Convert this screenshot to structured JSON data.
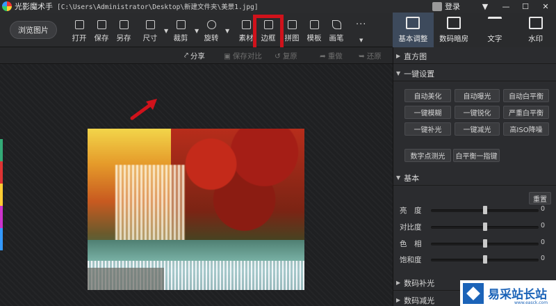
{
  "window": {
    "app_name": "光影魔术手",
    "path": "[C:\\Users\\Administrator\\Desktop\\新建文件夹\\美景1.jpg]",
    "login_label": "登录",
    "controls": [
      "▼",
      "—",
      "☐",
      "✕"
    ]
  },
  "toolbar": {
    "browse_label": "浏览图片",
    "tools": [
      {
        "label": "打开",
        "icon": "open-icon"
      },
      {
        "label": "保存",
        "icon": "save-icon"
      },
      {
        "label": "另存",
        "icon": "save-as-icon"
      },
      {
        "label": "尺寸",
        "icon": "resize-icon"
      },
      {
        "label": "裁剪",
        "icon": "crop-icon"
      },
      {
        "label": "旋转",
        "icon": "rotate-icon"
      },
      {
        "label": "素材",
        "icon": "material-icon"
      },
      {
        "label": "边框",
        "icon": "border-icon"
      },
      {
        "label": "拼图",
        "icon": "collage-icon"
      },
      {
        "label": "模板",
        "icon": "template-icon"
      },
      {
        "label": "画笔",
        "icon": "brush-icon"
      }
    ],
    "more_label": "···"
  },
  "right_tabs": [
    {
      "label": "基本调整",
      "icon": "adjust-icon",
      "active": true
    },
    {
      "label": "数码暗房",
      "icon": "darkroom-icon",
      "active": false
    },
    {
      "label": "文字",
      "icon": "text-icon",
      "active": false
    },
    {
      "label": "水印",
      "icon": "watermark-icon",
      "active": false
    }
  ],
  "subbar": {
    "share": "分享",
    "save_compare": "保存对比",
    "reset_all": "复原",
    "undo": "重做",
    "redo": "还原"
  },
  "panel": {
    "histogram": "直方图",
    "one_click": "一键设置",
    "one_click_buttons": [
      [
        "自动美化",
        "自动曝光",
        "自动白平衡"
      ],
      [
        "一键模糊",
        "一键锐化",
        "严重白平衡"
      ],
      [
        "一键补光",
        "一键减光",
        "高ISO降噪"
      ]
    ],
    "extra_buttons": [
      "数字点测光",
      "白平衡一指键"
    ],
    "basic": "基本",
    "reset": "重置",
    "sliders": [
      {
        "label": "亮　度",
        "value": "0",
        "level": 0.5
      },
      {
        "label": "对比度",
        "value": "0",
        "level": 0.5
      },
      {
        "label": "色　相",
        "value": "0",
        "level": 0.5
      },
      {
        "label": "饱和度",
        "value": "0",
        "level": 0.5
      }
    ],
    "fill_light": "数码补光",
    "reduce_light": "数码减光"
  },
  "watermark": {
    "text": "易采站长站",
    "sub": "www.easck.com"
  },
  "colors": {
    "highlight": "#d0121b",
    "active_tab": "#3d4a5c",
    "brand": "#1b63b8"
  }
}
